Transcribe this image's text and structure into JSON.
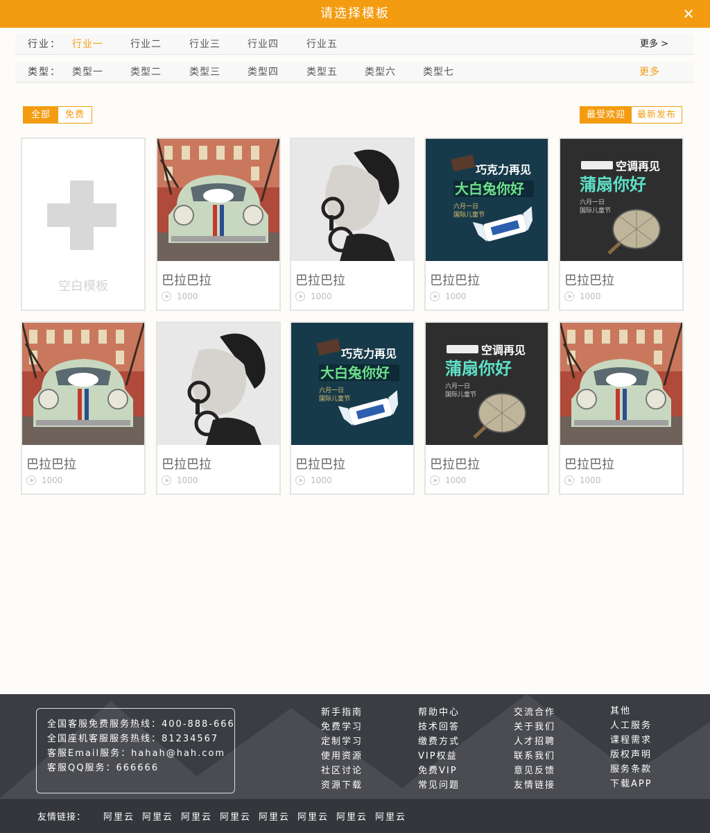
{
  "header": {
    "title": "请选择模板",
    "close_symbol": "✕"
  },
  "filters": {
    "industry": {
      "label": "行业：",
      "options": [
        "行业一",
        "行业二",
        "行业三",
        "行业四",
        "行业五"
      ],
      "active_index": 0,
      "more": "更多 >"
    },
    "type": {
      "label": "类型：",
      "options": [
        "类型一",
        "类型二",
        "类型三",
        "类型四",
        "类型五",
        "类型六",
        "类型七"
      ],
      "more": "更多"
    }
  },
  "toggles": {
    "price": [
      "全部",
      "免费"
    ],
    "price_active": 0,
    "sort": [
      "最受欢迎",
      "最新发布"
    ],
    "sort_active": 0
  },
  "blank_template": {
    "label": "空白模板"
  },
  "templates": [
    {
      "title": "巴拉巴拉",
      "views": "1000",
      "image": "car"
    },
    {
      "title": "巴拉巴拉",
      "views": "1000",
      "image": "man"
    },
    {
      "title": "巴拉巴拉",
      "views": "1000",
      "image": "candy"
    },
    {
      "title": "巴拉巴拉",
      "views": "1000",
      "image": "fan"
    },
    {
      "title": "巴拉巴拉",
      "views": "1000",
      "image": "car"
    },
    {
      "title": "巴拉巴拉",
      "views": "1000",
      "image": "man"
    },
    {
      "title": "巴拉巴拉",
      "views": "1000",
      "image": "candy"
    },
    {
      "title": "巴拉巴拉",
      "views": "1000",
      "image": "fan"
    },
    {
      "title": "巴拉巴拉",
      "views": "1000",
      "image": "car"
    }
  ],
  "poster_text": {
    "candy": {
      "line1": "巧克力再见",
      "line2": "大白兔你好",
      "line3": "六月一日",
      "line4": "国际儿童节"
    },
    "fan": {
      "line1": "空调再见",
      "line2": "蒲扇你好",
      "line3": "六月一日",
      "line4": "国际儿童节"
    }
  },
  "footer": {
    "contact": [
      "全国客服免费服务热线：400-888-666",
      "全国座机客服服务热线：81234567",
      "客服Email服务：hahah@hah.com",
      "客服QQ服务：666666"
    ],
    "columns": [
      [
        "新手指南",
        "免费学习",
        "定制学习",
        "使用资源",
        "社区讨论",
        "资源下载"
      ],
      [
        "帮助中心",
        "技术回答",
        "缴费方式",
        "VIP权益",
        "免费VIP",
        "常见问题"
      ],
      [
        "交流合作",
        "关于我们",
        "人才招聘",
        "联系我们",
        "意见反馈",
        "友情链接"
      ],
      [
        "其他",
        "人工服务",
        "课程需求",
        "版权声明",
        "服务条款",
        "下载APP"
      ]
    ],
    "friend_label": "友情链接：",
    "friend_links": [
      "阿里云",
      "阿里云",
      "阿里云",
      "阿里云",
      "阿里云",
      "阿里云",
      "阿里云",
      "阿里云"
    ]
  }
}
